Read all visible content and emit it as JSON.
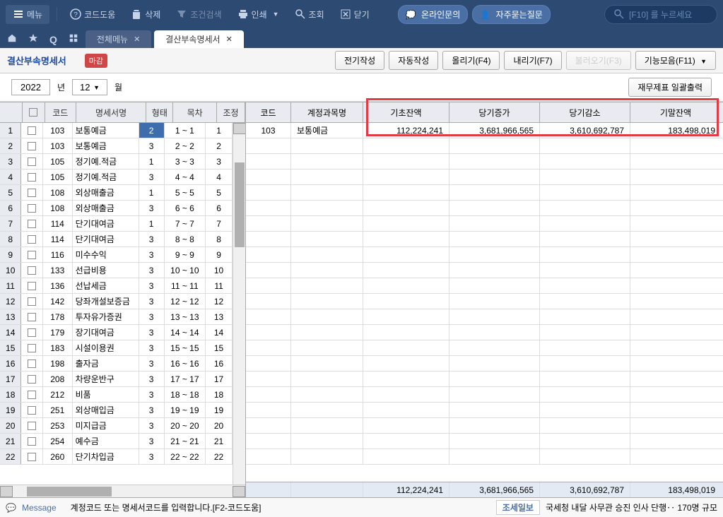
{
  "toolbar": {
    "menu": "메뉴",
    "codeHelp": "코드도움",
    "delete": "삭제",
    "condSearch": "조건검색",
    "print": "인쇄",
    "search": "조회",
    "close": "닫기",
    "onlineInquiry": "온라인문의",
    "faq": "자주묻는질문",
    "searchPlaceholder": "[F10] 를 누르세요"
  },
  "tabs": {
    "allMenu": "전체메뉴",
    "currentTab": "결산부속명세서"
  },
  "actionBar": {
    "title": "결산부속명세서",
    "badge": "마감",
    "prevPeriod": "전기작성",
    "autoCreate": "자동작성",
    "upload": "올리기(F4)",
    "download": "내리기(F7)",
    "import": "불러오기(F3)",
    "functions": "기능모음(F11)"
  },
  "filter": {
    "year": "2022",
    "yearLabel": "년",
    "month": "12",
    "monthLabel": "월",
    "batchPrint": "재무제표 일괄출력"
  },
  "leftGrid": {
    "headers": {
      "code": "코드",
      "name": "명세서명",
      "form": "형태",
      "toc": "목차",
      "adj": "조정"
    },
    "rows": [
      {
        "no": "1",
        "code": "103",
        "name": "보통예금",
        "form": "2",
        "toc": "1 ~ 1",
        "adj": "1"
      },
      {
        "no": "2",
        "code": "103",
        "name": "보통예금",
        "form": "3",
        "toc": "2 ~ 2",
        "adj": "2"
      },
      {
        "no": "3",
        "code": "105",
        "name": "정기예.적금",
        "form": "1",
        "toc": "3 ~ 3",
        "adj": "3"
      },
      {
        "no": "4",
        "code": "105",
        "name": "정기예.적금",
        "form": "3",
        "toc": "4 ~ 4",
        "adj": "4"
      },
      {
        "no": "5",
        "code": "108",
        "name": "외상매출금",
        "form": "1",
        "toc": "5 ~ 5",
        "adj": "5"
      },
      {
        "no": "6",
        "code": "108",
        "name": "외상매출금",
        "form": "3",
        "toc": "6 ~ 6",
        "adj": "6"
      },
      {
        "no": "7",
        "code": "114",
        "name": "단기대여금",
        "form": "1",
        "toc": "7 ~ 7",
        "adj": "7"
      },
      {
        "no": "8",
        "code": "114",
        "name": "단기대여금",
        "form": "3",
        "toc": "8 ~ 8",
        "adj": "8"
      },
      {
        "no": "9",
        "code": "116",
        "name": "미수수익",
        "form": "3",
        "toc": "9 ~ 9",
        "adj": "9"
      },
      {
        "no": "10",
        "code": "133",
        "name": "선급비용",
        "form": "3",
        "toc": "10 ~ 10",
        "adj": "10"
      },
      {
        "no": "11",
        "code": "136",
        "name": "선납세금",
        "form": "3",
        "toc": "11 ~ 11",
        "adj": "11"
      },
      {
        "no": "12",
        "code": "142",
        "name": "당좌개설보증금",
        "form": "3",
        "toc": "12 ~ 12",
        "adj": "12"
      },
      {
        "no": "13",
        "code": "178",
        "name": "투자유가증권",
        "form": "3",
        "toc": "13 ~ 13",
        "adj": "13"
      },
      {
        "no": "14",
        "code": "179",
        "name": "장기대여금",
        "form": "3",
        "toc": "14 ~ 14",
        "adj": "14"
      },
      {
        "no": "15",
        "code": "183",
        "name": "시설이용권",
        "form": "3",
        "toc": "15 ~ 15",
        "adj": "15"
      },
      {
        "no": "16",
        "code": "198",
        "name": "출자금",
        "form": "3",
        "toc": "16 ~ 16",
        "adj": "16"
      },
      {
        "no": "17",
        "code": "208",
        "name": "차량운반구",
        "form": "3",
        "toc": "17 ~ 17",
        "adj": "17"
      },
      {
        "no": "18",
        "code": "212",
        "name": "비품",
        "form": "3",
        "toc": "18 ~ 18",
        "adj": "18"
      },
      {
        "no": "19",
        "code": "251",
        "name": "외상매입금",
        "form": "3",
        "toc": "19 ~ 19",
        "adj": "19"
      },
      {
        "no": "20",
        "code": "253",
        "name": "미지급금",
        "form": "3",
        "toc": "20 ~ 20",
        "adj": "20"
      },
      {
        "no": "21",
        "code": "254",
        "name": "예수금",
        "form": "3",
        "toc": "21 ~ 21",
        "adj": "21"
      },
      {
        "no": "22",
        "code": "260",
        "name": "단기차입금",
        "form": "3",
        "toc": "22 ~ 22",
        "adj": "22"
      }
    ]
  },
  "rightGrid": {
    "headers": {
      "code": "코드",
      "accountName": "계정과목명",
      "beginBalance": "기초잔액",
      "increase": "당기증가",
      "decrease": "당기감소",
      "endBalance": "기말잔액"
    },
    "rows": [
      {
        "code": "103",
        "name": "보통예금",
        "begin": "112,224,241",
        "inc": "3,681,966,565",
        "dec": "3,610,692,787",
        "end": "183,498,019"
      }
    ],
    "totals": {
      "begin": "112,224,241",
      "inc": "3,681,966,565",
      "dec": "3,610,692,787",
      "end": "183,498,019"
    }
  },
  "statusBar": {
    "message": "Message",
    "hint": "계정코드 또는 명세서코드를 입력합니다.[F2-코드도움]",
    "newsLabel": "조세일보",
    "news": "국세청 내달 사무관 승진 인사 단행‥ 170명 규모"
  }
}
